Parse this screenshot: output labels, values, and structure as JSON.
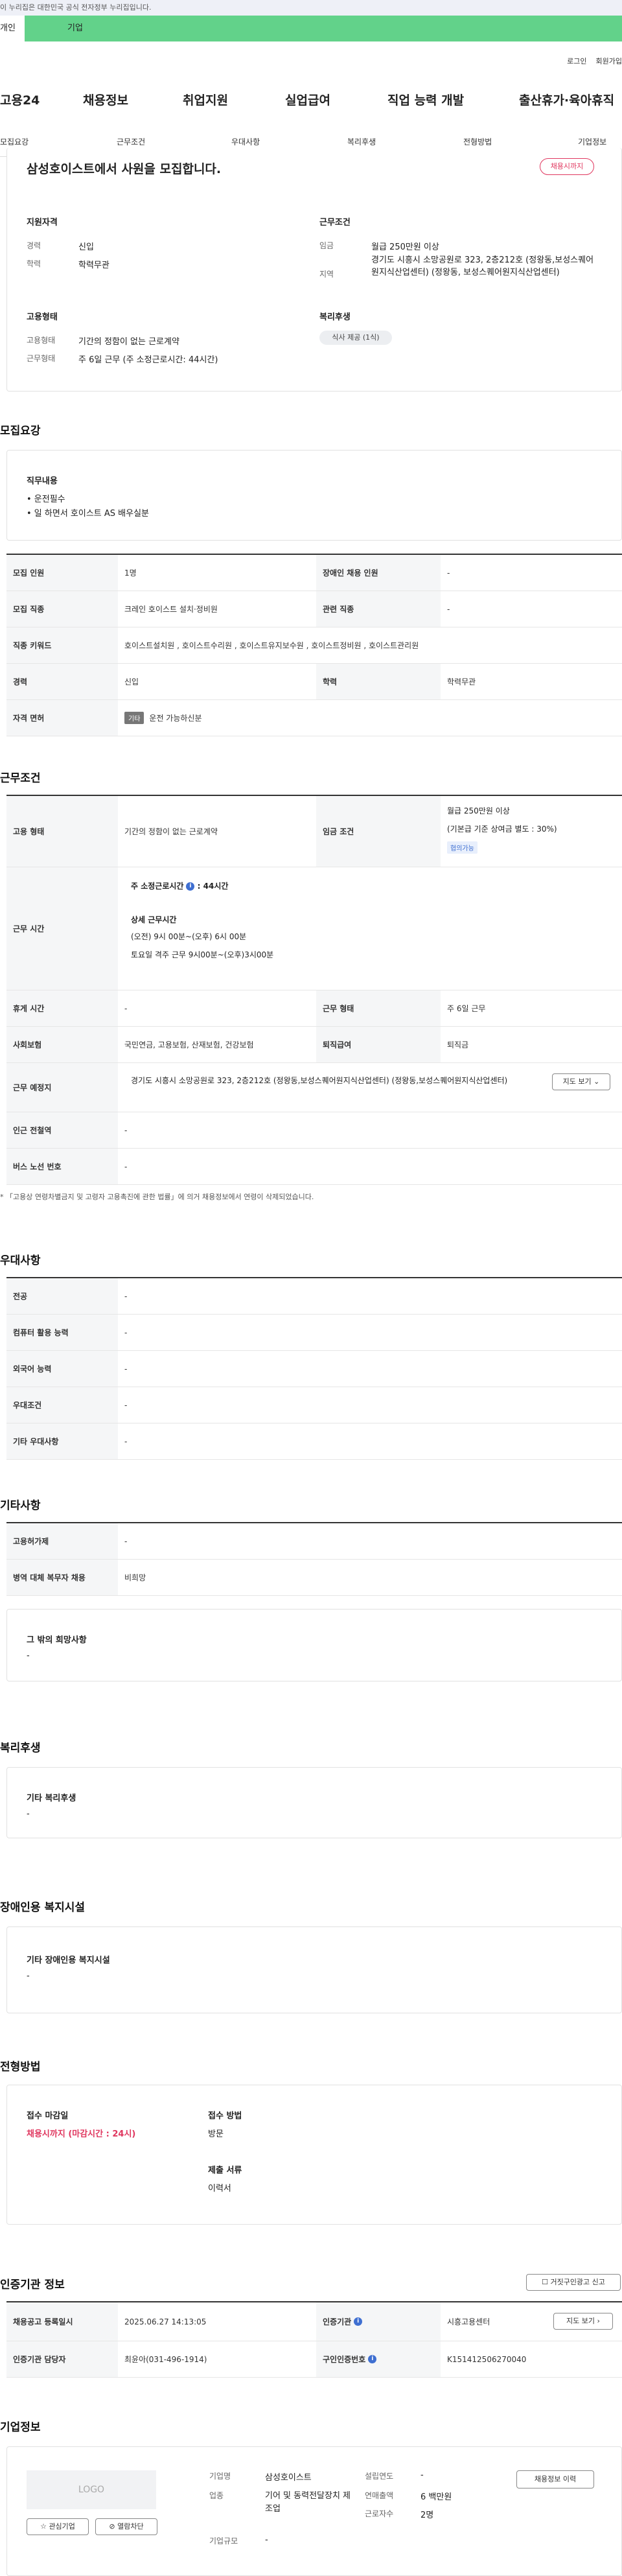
{
  "gov_banner": "이 누리집은 대한민국 공식 전자정부 누리집입니다.",
  "user_toggle": {
    "personal": "개인",
    "company": "기업"
  },
  "util_links": {
    "login": "로그인",
    "join": "회원가입"
  },
  "brand": "고용24",
  "gnb": [
    "채용정보",
    "취업지원",
    "실업급여",
    "직업 능력 개발",
    "출산휴가·육아휴직"
  ],
  "tabs": [
    "모집요강",
    "근무조건",
    "우대사항",
    "복리후생",
    "전형방법",
    "기업정보"
  ],
  "summary": {
    "title": "삼성호이스트에서 사원을 모집합니다.",
    "deadline_badge": "채용시까지",
    "qual_title": "지원자격",
    "career_label": "경력",
    "career_value": "신입",
    "edu_label": "학력",
    "edu_value": "학력무관",
    "cond_title": "근무조건",
    "wage_label": "임금",
    "wage_value": "월급 250만원 이상",
    "region_label": "지역",
    "region_value": "경기도 시흥시 소망공원로 323, 2층212호 (정왕동,보성스퀘어원지식산업센터) (정왕동, 보성스퀘어원지식산업센터)",
    "emp_title": "고용형태",
    "emp_type_label": "고용형태",
    "emp_type_value": "기간의 정함이 없는 근로계약",
    "work_label": "근무형태",
    "work_value": "주 6일 근무 (주 소정근로시간: 44시간)",
    "welfare_title": "복리후생",
    "welfare_tag": "식사 제공 (1식)"
  },
  "recruit": {
    "heading": "모집요강",
    "duty_title": "직무내용",
    "duty_lines": [
      "• 운전필수",
      "• 일 하면서 호이스트 AS 배우실분"
    ],
    "rows": [
      {
        "th": "모집 인원",
        "td": "1명",
        "th2": "장애인 채용 인원",
        "td2": "-"
      },
      {
        "th": "모집 직종",
        "td": "크레인 호이스트 설치·정비원",
        "th2": "관련 직종",
        "td2": "-"
      },
      {
        "th": "직종 키워드",
        "td": "호이스트설치원 , 호이스트수리원 , 호이스트유지보수원 , 호이스트정비원 , 호이스트관리원"
      },
      {
        "th": "경력",
        "td": "신입",
        "th2": "학력",
        "td2": "학력무관"
      },
      {
        "th": "자격 면허",
        "tag": "기타",
        "td": "운전 가능하신분"
      }
    ]
  },
  "work": {
    "heading": "근무조건",
    "emp_th": "고용 형태",
    "emp_td": "기간의 정함이 없는 근로계약",
    "wage_th": "임금 조건",
    "wage_l1": "월급 250만원 이상",
    "wage_l2": "(기본급 기준 상여금 별도 : 30%)",
    "wage_tag": "협의가능",
    "time_th": "근무 시간",
    "time_l1": "주 소정근로시간",
    "time_l1b": ": 44시간",
    "time_l2": "상세 근무시간",
    "time_l3": "(오전) 9시 00분~(오후) 6시 00분",
    "time_l4": "토요일 격주 근무 9시00분~(오후)3시00분",
    "rows": [
      {
        "th": "휴게 시간",
        "td": "-",
        "th2": "근무 형태",
        "td2": "주 6일 근무"
      },
      {
        "th": "사회보험",
        "td": "국민연금, 고용보험, 산재보험, 건강보험",
        "th2": "퇴직급여",
        "td2": "퇴직금"
      }
    ],
    "loc_th": "근무 예정지",
    "loc_td": "경기도 시흥시 소망공원로 323, 2층212호 (정왕동,보성스퀘어원지식산업센터) (정왕동,보성스퀘어원지식산업센터)",
    "map_btn": "지도 보기",
    "sub_th": "인근 전철역",
    "sub_td": "-",
    "bus_th": "버스 노선 번호",
    "bus_td": "-",
    "note": "* 「고용상 연령차별금지 및 고령자 고용촉진에 관한 법률」에 의거 채용정보에서 연령이 삭제되었습니다."
  },
  "pref": {
    "heading": "우대사항",
    "rows": [
      {
        "th": "전공",
        "td": "-"
      },
      {
        "th": "컴퓨터 활용 능력",
        "td": "-"
      },
      {
        "th": "외국어 능력",
        "td": "-"
      },
      {
        "th": "우대조건",
        "td": "-"
      },
      {
        "th": "기타 우대사항",
        "td": "-"
      }
    ]
  },
  "etc": {
    "heading": "기타사항",
    "rows": [
      {
        "th": "고용허가제",
        "td": "-"
      },
      {
        "th": "병역 대체 복무자 채용",
        "td": "비희망"
      }
    ],
    "other_title": "그 밖의 희망사항",
    "other_value": "-"
  },
  "welfare": {
    "heading": "복리후생",
    "title": "기타 복리후생",
    "value": "-"
  },
  "disabled": {
    "heading": "장애인용 복지시설",
    "title": "기타 장애인용 복지시설",
    "value": "-"
  },
  "selection": {
    "heading": "전형방법",
    "deadline_title": "접수 마감일",
    "deadline_value": "채용시까지 (마감시간 : 24시)",
    "method_title": "접수 방법",
    "method_value": "방문",
    "docs_title": "제출 서류",
    "docs_value": "이력서"
  },
  "cert": {
    "heading": "인증기관 정보",
    "report_btn": "거짓구인광고 신고",
    "r1_th": "채용공고 등록일시",
    "r1_td": "2025.06.27 14:13:05",
    "r1_th2": "인증기관",
    "r1_td2": "시흥고용센터",
    "map_btn": "지도 보기",
    "r2_th": "인증기관 담당자",
    "r2_td": "최윤아(031-496-1914)",
    "r2_th2": "구인인증번호",
    "r2_td2": "K151412506270040"
  },
  "company": {
    "heading": "기업정보",
    "logo_text": "LOGO",
    "fav_btn": "관심기업",
    "block_btn": "열람차단",
    "name_label": "기업명",
    "name_value": "삼성호이스트",
    "industry_label": "업종",
    "industry_value": "기어 및 동력전달장치 제조업",
    "size_label": "기업규모",
    "size_value": "-",
    "year_label": "설립연도",
    "year_value": "-",
    "sales_label": "연매출액",
    "sales_value": "6 백만원",
    "emp_label": "근로자수",
    "emp_value": "2명",
    "history_btn": "채용정보 이력"
  },
  "colors": {
    "brand_green": "#62d28a",
    "deadline_red": "#e0375f",
    "info_blue": "#3f6fd1"
  }
}
